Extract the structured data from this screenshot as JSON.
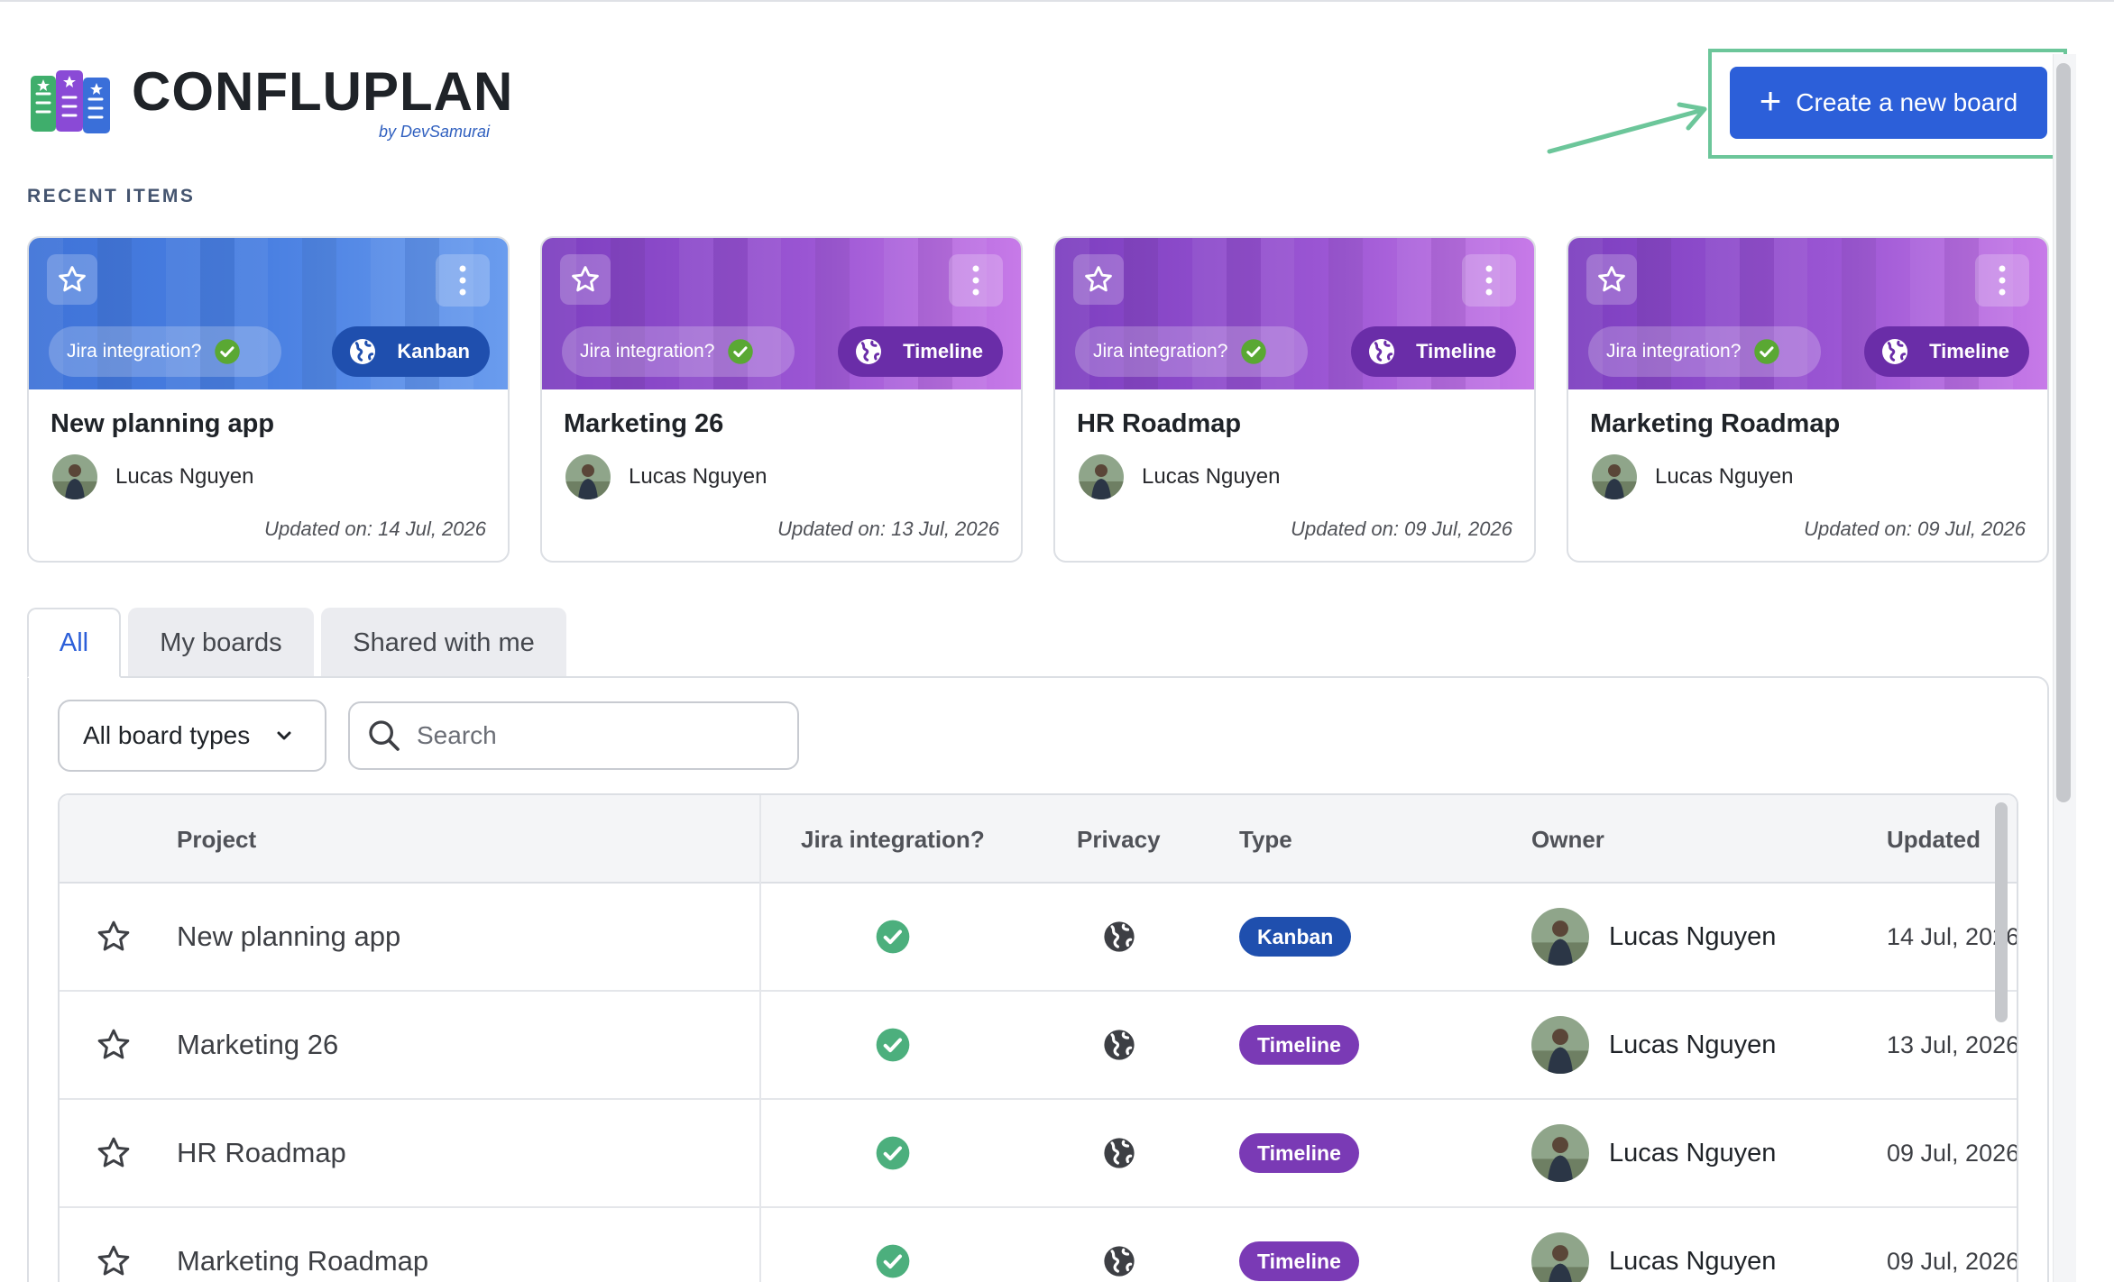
{
  "brand": {
    "name": "CONFLUPLAN",
    "subtitle": "by DevSamurai"
  },
  "header": {
    "create_button_label": "Create a new board"
  },
  "recent": {
    "section_label": "RECENT ITEMS",
    "jira_label": "Jira integration?",
    "cards": [
      {
        "title": "New planning app",
        "owner": "Lucas Nguyen",
        "type": "Kanban",
        "updated": "Updated on: 14 Jul, 2026"
      },
      {
        "title": "Marketing 26",
        "owner": "Lucas Nguyen",
        "type": "Timeline",
        "updated": "Updated on: 13 Jul, 2026"
      },
      {
        "title": "HR Roadmap",
        "owner": "Lucas Nguyen",
        "type": "Timeline",
        "updated": "Updated on: 09 Jul, 2026"
      },
      {
        "title": "Marketing Roadmap",
        "owner": "Lucas Nguyen",
        "type": "Timeline",
        "updated": "Updated on: 09 Jul, 2026"
      }
    ]
  },
  "tabs": [
    {
      "label": "All",
      "active": true
    },
    {
      "label": "My boards",
      "active": false
    },
    {
      "label": "Shared with me",
      "active": false
    }
  ],
  "filters": {
    "board_type_selected": "All board types",
    "search_placeholder": "Search"
  },
  "table": {
    "headers": {
      "project": "Project",
      "jira": "Jira integration?",
      "privacy": "Privacy",
      "type": "Type",
      "owner": "Owner",
      "updated": "Updated"
    },
    "rows": [
      {
        "project": "New planning app",
        "jira": true,
        "privacy": "public",
        "type": "Kanban",
        "owner": "Lucas Nguyen",
        "updated": "14 Jul, 2026"
      },
      {
        "project": "Marketing 26",
        "jira": true,
        "privacy": "public",
        "type": "Timeline",
        "owner": "Lucas Nguyen",
        "updated": "13 Jul, 2026"
      },
      {
        "project": "HR Roadmap",
        "jira": true,
        "privacy": "public",
        "type": "Timeline",
        "owner": "Lucas Nguyen",
        "updated": "09 Jul, 2026"
      },
      {
        "project": "Marketing Roadmap",
        "jira": true,
        "privacy": "public",
        "type": "Timeline",
        "owner": "Lucas Nguyen",
        "updated": "09 Jul, 2026"
      }
    ]
  },
  "colors": {
    "primary": "#2c5fd9",
    "kanban": "#1f4fae",
    "timeline": "#7a3ab5",
    "check": "#4caf7d",
    "highlight": "#6cc69a"
  }
}
